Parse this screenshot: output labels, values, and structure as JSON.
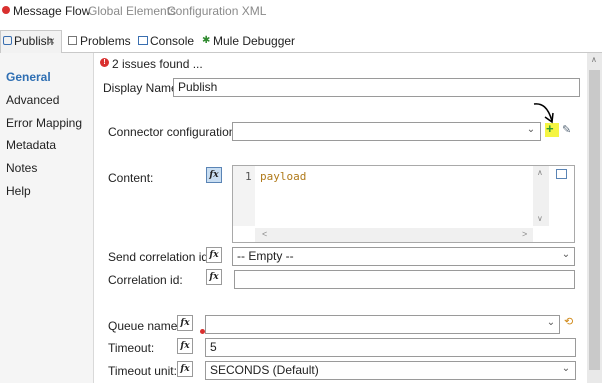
{
  "top_tabs": {
    "message_flow": "Message Flow",
    "global_elements": "Global Elements",
    "configuration_xml": "Configuration XML"
  },
  "view_tabs": {
    "publish": "Publish",
    "close": "×",
    "problems": "Problems",
    "console": "Console",
    "mule_debugger": "Mule Debugger"
  },
  "sidebar": {
    "items": [
      "General",
      "Advanced",
      "Error Mapping",
      "Metadata",
      "Notes",
      "Help"
    ],
    "active": "General"
  },
  "issues": {
    "text": "2 issues found ..."
  },
  "form": {
    "display_name_label": "Display Name:",
    "display_name_value": "Publish",
    "connector_config_label": "Connector configuration:",
    "connector_config_value": "",
    "content_label": "Content:",
    "content_line_number": "1",
    "content_code": "payload",
    "send_correlation_label": "Send correlation id:",
    "send_correlation_value": "-- Empty --",
    "correlation_id_label": "Correlation id:",
    "correlation_id_value": "",
    "queue_name_label": "Queue name:",
    "queue_name_value": "",
    "timeout_label": "Timeout:",
    "timeout_value": "5",
    "timeout_unit_label": "Timeout unit:",
    "timeout_unit_value": "SECONDS (Default)"
  },
  "icons": {
    "fx": "fx",
    "dropdown": "⌄",
    "error": "!",
    "add": "+",
    "edit": "✎"
  },
  "colors": {
    "accent": "#2f6fb3",
    "highlight": "#f5f542",
    "error": "#d9302f"
  }
}
